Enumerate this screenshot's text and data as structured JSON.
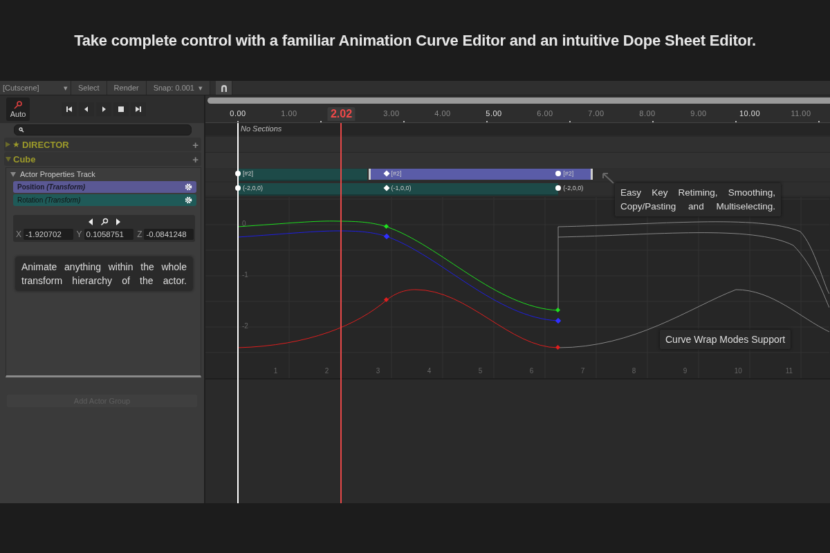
{
  "banner": {
    "headline": "Take complete control with a familiar Animation Curve Editor and an intuitive Dope Sheet Editor."
  },
  "toolbar": [
    {
      "kind": "dropdown",
      "label": "[Cutscene]",
      "caret": "▾"
    },
    {
      "kind": "button",
      "label": "Select"
    },
    {
      "kind": "button",
      "label": "Render"
    },
    {
      "kind": "dropdown",
      "label": "Snap: 0.001",
      "caret": "▾"
    },
    {
      "kind": "magnet"
    }
  ],
  "auto_key": {
    "label": "Auto"
  },
  "ruler": {
    "labels": [
      "0.00",
      "1.00",
      "3.00",
      "4.00",
      "5.00",
      "6.00",
      "7.00",
      "8.00",
      "9.00",
      "10.00",
      "11.00"
    ],
    "playhead": "2.02"
  },
  "sidebar": {
    "groups": [
      {
        "name": "DIRECTOR",
        "kind": "director",
        "star": "★",
        "add": "+",
        "expanded": false
      },
      {
        "name": "Cube",
        "kind": "actor",
        "add": "+",
        "expanded": true
      }
    ],
    "track": {
      "title": "Actor Properties Track",
      "expanded": true
    },
    "properties": [
      {
        "name": "Position",
        "component": "(Transform)",
        "selected": true,
        "color": "#5a5894"
      },
      {
        "name": "Rotation",
        "component": "(Transform)",
        "selected": false,
        "color": "#1f5a58"
      }
    ],
    "vector": [
      {
        "axis": "X",
        "value": "-1.920702"
      },
      {
        "axis": "Y",
        "value": "0.1058751"
      },
      {
        "axis": "Z",
        "value": "-0.0841248"
      }
    ],
    "note": "Animate anything within the whole transform hierarchy of the actor.",
    "add_button": {
      "label": "Add Actor Group",
      "disabled": true
    }
  },
  "timeline": {
    "sections_label": "No Sections",
    "position_keys": [
      {
        "kind": "circle",
        "label": "[#2]"
      },
      {
        "kind": "diamond",
        "label": "[#2]"
      },
      {
        "kind": "circle",
        "label": "[#2]"
      }
    ],
    "rotation_keys": [
      {
        "kind": "circle",
        "label": "(-2,0,0)"
      },
      {
        "kind": "diamond",
        "label": "(-1,0,0)"
      },
      {
        "kind": "circle",
        "label": "(-2,0,0)"
      }
    ],
    "curves": {
      "y_labels": [
        "0",
        "-1",
        "-2"
      ],
      "x_labels": [
        "1",
        "2",
        "3",
        "4",
        "5",
        "6",
        "7",
        "8",
        "9",
        "10",
        "11"
      ]
    },
    "notes": [
      {
        "kind": "keys",
        "text": "Easy Key Retiming, Smoothing, Copy/Pasting and Multiselecting."
      },
      {
        "kind": "curves",
        "text": "Curve Wrap Modes Support"
      }
    ]
  }
}
